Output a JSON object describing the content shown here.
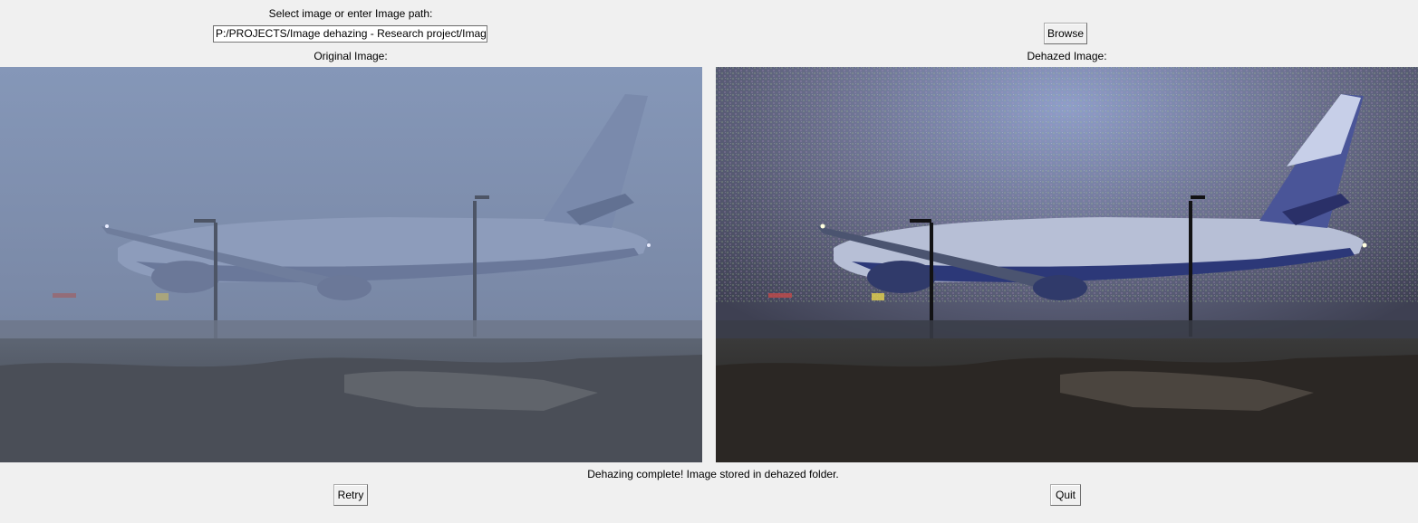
{
  "header": {
    "prompt_label": "Select image or enter Image path:",
    "path_value": "P:/PROJECTS/Image dehazing - Research project/Images/",
    "browse_label": "Browse"
  },
  "panels": {
    "original_caption": "Original Image:",
    "dehazed_caption": "Dehazed Image:"
  },
  "footer": {
    "status_text": "Dehazing complete! Image stored in dehazed folder.",
    "retry_label": "Retry",
    "quit_label": "Quit"
  },
  "colors": {
    "window_bg": "#f0f0f0",
    "original_sky": "#7f90b0",
    "dehazed_sky": "#5a5c6e"
  }
}
